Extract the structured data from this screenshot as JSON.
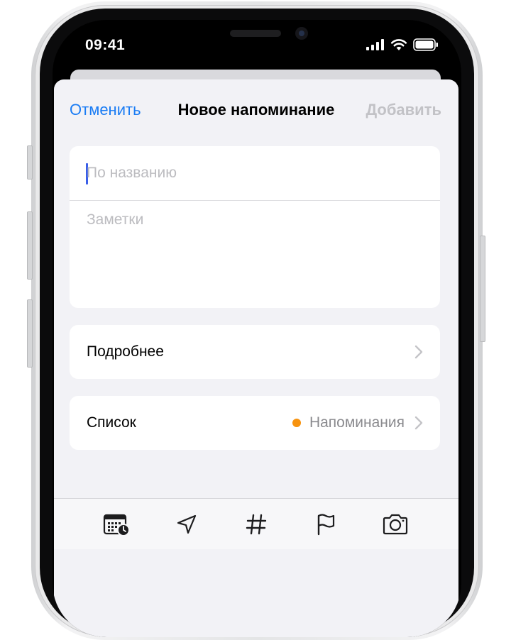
{
  "status_bar": {
    "time": "09:41"
  },
  "nav": {
    "cancel_label": "Отменить",
    "title": "Новое напоминание",
    "add_label": "Добавить"
  },
  "form": {
    "title_placeholder": "По названию",
    "notes_placeholder": "Заметки"
  },
  "details_row": {
    "label": "Подробнее"
  },
  "list_row": {
    "label": "Список",
    "value": "Напоминания",
    "dot_color": "#f7930f"
  },
  "toolbar": {
    "icons": [
      "calendar-clock-icon",
      "location-arrow-icon",
      "hashtag-icon",
      "flag-icon",
      "camera-icon"
    ]
  },
  "colors": {
    "accent": "#1a7cf4",
    "disabled": "#c2c2c6",
    "sheet_bg": "#f2f2f6",
    "secondary_text": "#8a8a8e"
  }
}
